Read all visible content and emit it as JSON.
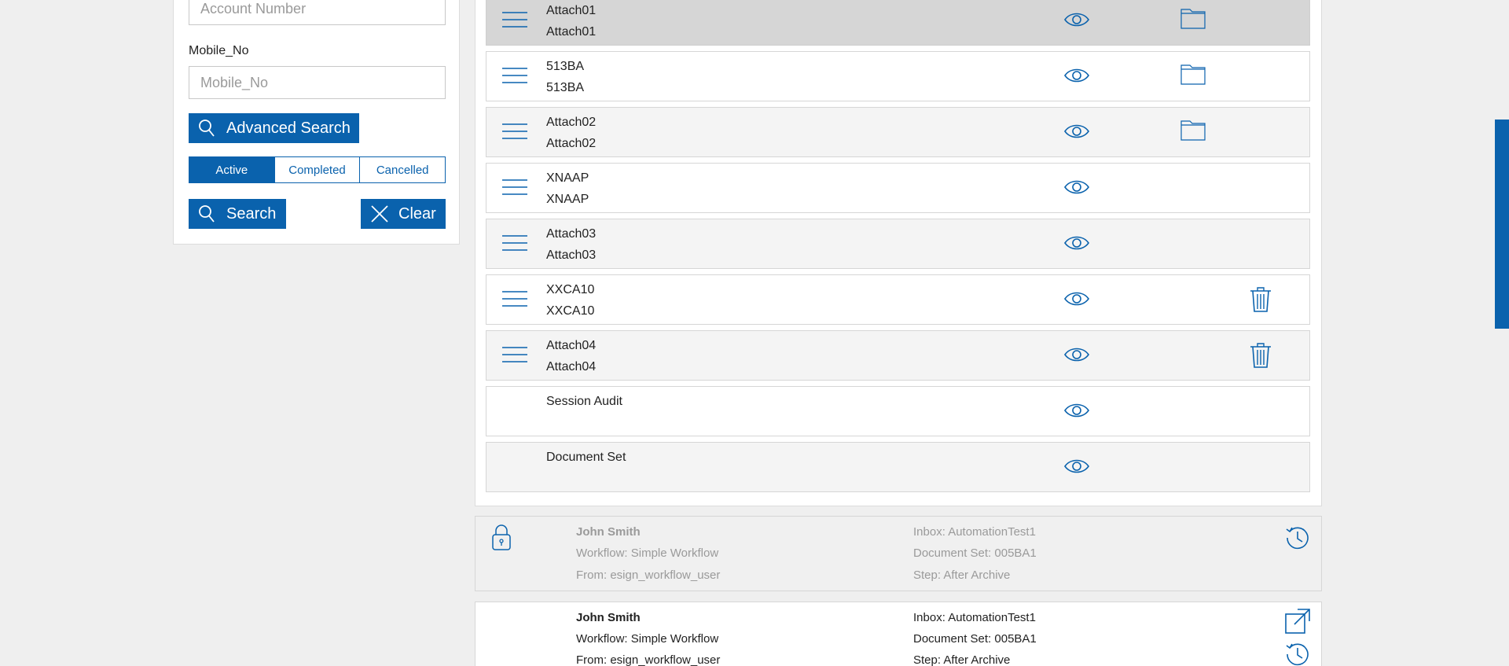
{
  "search_panel": {
    "account_number_placeholder": "Account Number",
    "mobile_label": "Mobile_No",
    "mobile_placeholder": "Mobile_No",
    "advanced_search_label": "Advanced Search",
    "status_tabs": [
      "Active",
      "Completed",
      "Cancelled"
    ],
    "active_status": "Active",
    "search_label": "Search",
    "clear_label": "Clear"
  },
  "documents": [
    {
      "name": "Attach01",
      "sub": "Attach01",
      "icon": "folder-icon",
      "selected": true
    },
    {
      "name": "513BA",
      "sub": "513BA",
      "icon": "folder-icon"
    },
    {
      "name": "Attach02",
      "sub": "Attach02",
      "icon": "folder-icon"
    },
    {
      "name": "XNAAP",
      "sub": "XNAAP",
      "icon": ""
    },
    {
      "name": "Attach03",
      "sub": "Attach03",
      "icon": ""
    },
    {
      "name": "XXCA10",
      "sub": "XXCA10",
      "icon": "trash-icon"
    },
    {
      "name": "Attach04",
      "sub": "Attach04",
      "icon": "trash-icon"
    },
    {
      "name": "Session Audit",
      "sub": "",
      "icon": ""
    },
    {
      "name": "Document Set",
      "sub": "",
      "icon": ""
    }
  ],
  "tasks": [
    {
      "user": "John Smith",
      "workflow": "Workflow: Simple Workflow",
      "from": "From: esign_workflow_user",
      "inbox": "Inbox: AutomationTest1",
      "document_set": "Document Set: 005BA1",
      "step": "Step: After Archive"
    },
    {
      "user": "John Smith",
      "workflow": "Workflow: Simple Workflow",
      "from": "From: esign_workflow_user",
      "inbox": "Inbox: AutomationTest1",
      "document_set": "Document Set: 005BA1",
      "step": "Step: After Archive"
    }
  ],
  "colors": {
    "accent": "#0a62ad",
    "row_selected": "#d6d6d6",
    "row_alt": "#f4f4f4",
    "background": "#efefef"
  }
}
